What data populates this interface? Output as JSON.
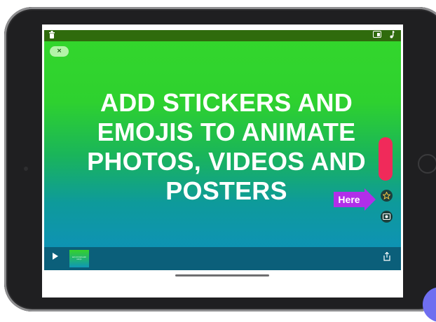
{
  "topbar": {
    "left_icon": "trash-icon",
    "right_icons": [
      "layout-icon",
      "music-icon"
    ]
  },
  "close_button": {
    "label": "×"
  },
  "headline": {
    "text": "ADD STICKERS AND EMOJIS TO ANIMATE PHOTOS, VIDEOS AND POSTERS"
  },
  "tools": {
    "pill_color": "#f02a5a",
    "sticker_icon": "star-sticker-icon",
    "photo_icon": "photo-add-icon"
  },
  "callout": {
    "label": "Here",
    "color": "#b12ee9"
  },
  "bottombar": {
    "play_icon": "play-icon",
    "share_icon": "share-icon",
    "thumbnail_text": "ADD STICKERS AND EMOJIS"
  },
  "colors": {
    "gradient_top": "#34d72c",
    "gradient_bottom": "#0d8fc0",
    "topbar": "#2f6b0d",
    "bottombar": "#0b5f7a"
  }
}
